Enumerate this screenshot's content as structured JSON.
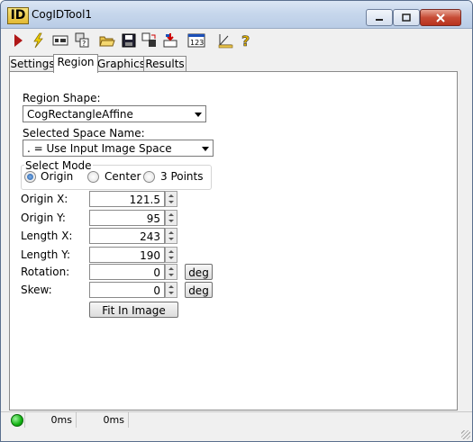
{
  "window": {
    "title": "CogIDTool1",
    "icon_text": "ID"
  },
  "toolbar": {
    "icons": [
      "run-icon",
      "run-continuous-icon",
      "electric-icon",
      "show-results-icon",
      "open-icon",
      "save-icon",
      "grab-image-icon",
      "reset-icon",
      "numeric-display-icon",
      "measure-icon",
      "help-icon"
    ]
  },
  "tabs": [
    {
      "label": "Settings"
    },
    {
      "label": "Region"
    },
    {
      "label": "Graphics"
    },
    {
      "label": "Results"
    }
  ],
  "region": {
    "shape_label": "Region Shape:",
    "shape_value": "CogRectangleAffine",
    "space_label": "Selected Space Name:",
    "space_value": ". = Use Input Image Space",
    "mode_label": "Select Mode",
    "modes": [
      {
        "label": "Origin",
        "checked": true
      },
      {
        "label": "Center",
        "checked": false
      },
      {
        "label": "3 Points",
        "checked": false
      }
    ],
    "fields": [
      {
        "label": "Origin X:",
        "value": "121.5"
      },
      {
        "label": "Origin Y:",
        "value": "95"
      },
      {
        "label": "Length X:",
        "value": "243"
      },
      {
        "label": "Length Y:",
        "value": "190"
      },
      {
        "label": "Rotation:",
        "value": "0",
        "unit": "deg"
      },
      {
        "label": "Skew:",
        "value": "0",
        "unit": "deg"
      }
    ],
    "fit_button": "Fit In Image"
  },
  "status": {
    "time1": "0ms",
    "time2": "0ms"
  }
}
